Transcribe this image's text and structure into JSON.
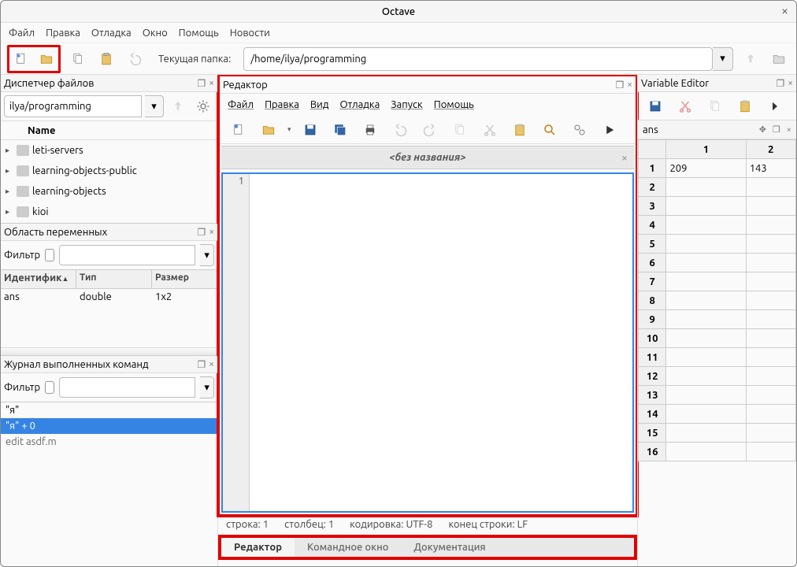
{
  "window": {
    "title": "Octave"
  },
  "main_menu": [
    "Файл",
    "Правка",
    "Отладка",
    "Окно",
    "Помощь",
    "Новости"
  ],
  "toolbar": {
    "current_folder_label": "Текущая папка:",
    "current_folder_path": "/home/ilya/programming"
  },
  "file_manager": {
    "title": "Диспетчер файлов",
    "path_value": "ilya/programming",
    "name_header": "Name",
    "items": [
      "leti-servers",
      "learning-objects-public",
      "learning-objects",
      "kioi"
    ]
  },
  "workspace": {
    "title": "Область переменных",
    "filter_label": "Фильтр",
    "headers": {
      "id": "Идентифик",
      "type": "Тип",
      "size": "Размер"
    },
    "rows": [
      {
        "id": "ans",
        "type": "double",
        "size": "1x2"
      }
    ]
  },
  "history": {
    "title": "Журнал выполненных команд",
    "filter_label": "Фильтр",
    "items": [
      {
        "text": "\"я\"",
        "selected": false
      },
      {
        "text": "\"я\" + 0",
        "selected": true
      },
      {
        "text": "edit asdf.m",
        "selected": false,
        "truncated": true
      }
    ]
  },
  "editor": {
    "panel_title": "Редактор",
    "menu": [
      "Файл",
      "Правка",
      "Вид",
      "Отладка",
      "Запуск",
      "Помощь"
    ],
    "tab_title": "<без названия>",
    "gutter_lines": [
      "1"
    ],
    "status": {
      "line_label": "строка:",
      "line_val": "1",
      "col_label": "столбец:",
      "col_val": "1",
      "enc_label": "кодировка:",
      "enc_val": "UTF-8",
      "eol_label": "конец строки:",
      "eol_val": "LF"
    }
  },
  "bottom_tabs": [
    {
      "label": "Редактор",
      "active": true
    },
    {
      "label": "Командное окно",
      "active": false
    },
    {
      "label": "Документация",
      "active": false
    }
  ],
  "variable_editor": {
    "title": "Variable Editor",
    "tab": "ans",
    "col_headers": [
      "1",
      "2"
    ],
    "rows": [
      {
        "hdr": "1",
        "cells": [
          "209",
          "143"
        ]
      },
      {
        "hdr": "2",
        "cells": [
          "",
          ""
        ]
      },
      {
        "hdr": "3",
        "cells": [
          "",
          ""
        ]
      },
      {
        "hdr": "4",
        "cells": [
          "",
          ""
        ]
      },
      {
        "hdr": "5",
        "cells": [
          "",
          ""
        ]
      },
      {
        "hdr": "6",
        "cells": [
          "",
          ""
        ]
      },
      {
        "hdr": "7",
        "cells": [
          "",
          ""
        ]
      },
      {
        "hdr": "8",
        "cells": [
          "",
          ""
        ]
      },
      {
        "hdr": "9",
        "cells": [
          "",
          ""
        ]
      },
      {
        "hdr": "10",
        "cells": [
          "",
          ""
        ]
      },
      {
        "hdr": "11",
        "cells": [
          "",
          ""
        ]
      },
      {
        "hdr": "12",
        "cells": [
          "",
          ""
        ]
      },
      {
        "hdr": "13",
        "cells": [
          "",
          ""
        ]
      },
      {
        "hdr": "14",
        "cells": [
          "",
          ""
        ]
      },
      {
        "hdr": "15",
        "cells": [
          "",
          ""
        ]
      },
      {
        "hdr": "16",
        "cells": [
          "",
          ""
        ]
      }
    ]
  }
}
